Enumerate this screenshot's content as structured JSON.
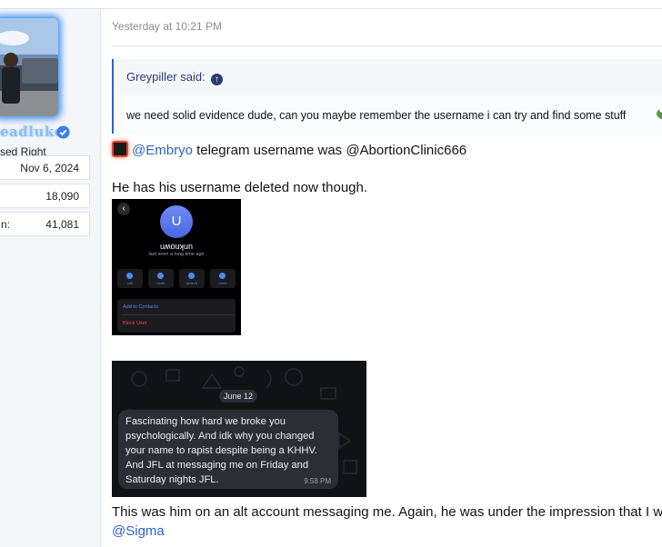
{
  "user": {
    "name": "eadluke",
    "title": "sed Right",
    "stats": [
      {
        "label": "",
        "value": "Nov 6, 2024"
      },
      {
        "label": "",
        "value": "18,090"
      },
      {
        "label": "n:",
        "value": "41,081"
      }
    ]
  },
  "post": {
    "date": "Yesterday at 10:21 PM",
    "quote": {
      "author": "Greypiller said:",
      "text": "we need solid evidence dude, can you maybe remember the username i can try and find some stuff"
    },
    "line1": {
      "mention": "@Embryo",
      "rest": " telegram username was @AbortionClinic666"
    },
    "line2": "He has his username deleted now though.",
    "screenshot1": {
      "back": "‹",
      "avatar_letter": "U",
      "name": "uʍouʞun",
      "last_seen": "last seen a long time ago",
      "buttons": [
        "call",
        "mute",
        "search",
        "more"
      ],
      "menu_add": "Add to Contacts",
      "menu_block": "Block User"
    },
    "screenshot2": {
      "date": "June 12",
      "message": "Fascinating how hard we broke you psychologically. And idk why you changed your name to rapist despite being a KHHV. And JFL at messaging me on Friday and Saturday nights JFL.",
      "time": "9:58 PM"
    },
    "line3": "This was him on an alt account messaging me. Again, he was under the impression that I w",
    "line4": "@Sigma"
  },
  "colors": {
    "accent": "#2b64c6",
    "quote_author": "#2b3a7a",
    "username_glow": "#8bbcf2"
  }
}
